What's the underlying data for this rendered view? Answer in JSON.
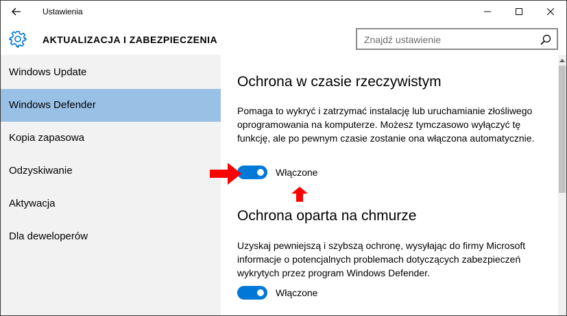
{
  "window": {
    "title": "Ustawienia"
  },
  "header": {
    "section_title": "AKTUALIZACJA I ZABEZPIECZENIA",
    "search_placeholder": "Znajdź ustawienie"
  },
  "sidebar": {
    "items": [
      {
        "label": "Windows Update",
        "selected": false
      },
      {
        "label": "Windows Defender",
        "selected": true
      },
      {
        "label": "Kopia zapasowa",
        "selected": false
      },
      {
        "label": "Odzyskiwanie",
        "selected": false
      },
      {
        "label": "Aktywacja",
        "selected": false
      },
      {
        "label": "Dla deweloperów",
        "selected": false
      }
    ]
  },
  "content": {
    "realtime": {
      "heading": "Ochrona w czasie rzeczywistym",
      "description": "Pomaga to wykryć i zatrzymać instalację lub uruchamianie złośliwego oprogramowania na komputerze. Możesz tymczasowo wyłączyć tę funkcję, ale po pewnym czasie zostanie ona włączona automatycznie.",
      "toggle_label": "Włączone",
      "toggle_on": true
    },
    "cloud": {
      "heading": "Ochrona oparta na chmurze",
      "description": "Uzyskaj pewniejszą i szybszą ochronę, wysyłając do firmy Microsoft informacje o potencjalnych problemach dotyczących zabezpieczeń wykrytych przez program Windows Defender.",
      "toggle_label": "Włączone",
      "toggle_on": true
    }
  },
  "colors": {
    "accent": "#0078d7",
    "selected_nav": "#99c1e6",
    "sidebar_bg": "#f2f2f2",
    "annotation_arrow": "#ff0000"
  },
  "icons": {
    "back": "back-arrow-icon",
    "settings": "gear-icon",
    "search": "search-icon",
    "minimize": "minimize-icon",
    "maximize": "maximize-icon",
    "close": "close-icon"
  }
}
